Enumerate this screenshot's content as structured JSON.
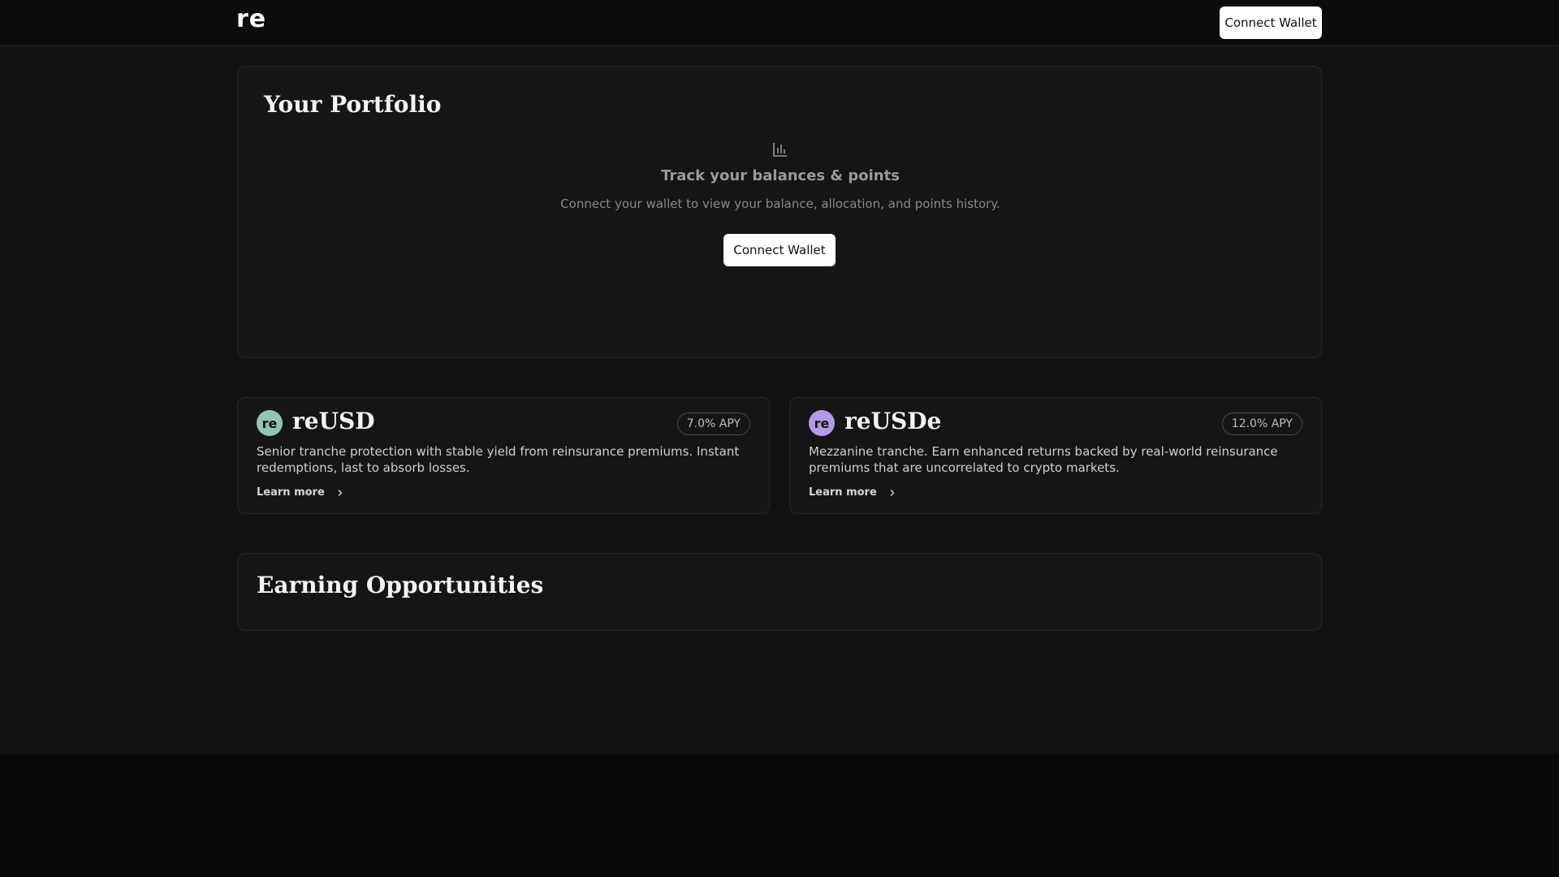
{
  "header": {
    "logo": "re",
    "connect_label": "Connect Wallet"
  },
  "portfolio": {
    "title": "Your Portfolio",
    "icon": "bar-chart-icon",
    "empty_title": "Track your balances & points",
    "empty_subtitle": "Connect your wallet to view your balance, allocation, and points history.",
    "connect_label": "Connect Wallet"
  },
  "products": [
    {
      "badge": "re",
      "badge_color": "#8fc7b4",
      "name": "reUSD",
      "apy": "7.0% APY",
      "description": "Senior tranche protection with stable yield from reinsurance premiums. Instant redemptions, last to absorb losses.",
      "learn_more": "Learn more"
    },
    {
      "badge": "re",
      "badge_color": "#b49be8",
      "name": "reUSDe",
      "apy": "12.0% APY",
      "description": "Mezzanine tranche. Earn enhanced returns backed by real-world reinsurance premiums that are uncorrelated to crypto markets.",
      "learn_more": "Learn more"
    }
  ],
  "earning": {
    "title": "Earning Opportunities"
  },
  "colors": {
    "background": "#111111",
    "panel": "#151515",
    "border": "#262626",
    "button": "#ffffff"
  }
}
